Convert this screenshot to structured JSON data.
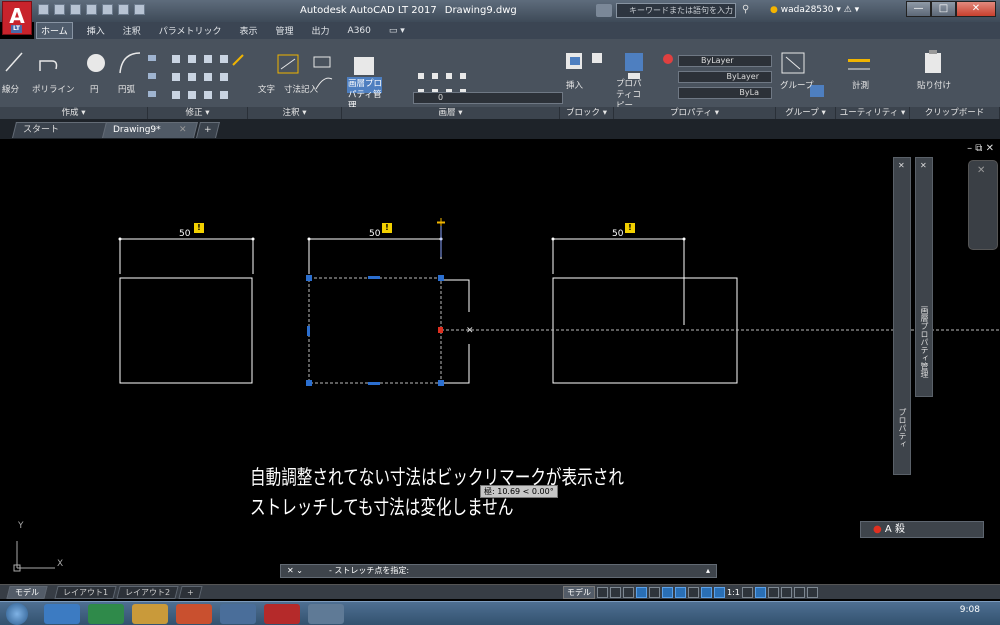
{
  "app": {
    "logo_letter": "A",
    "logo_badge": "LT",
    "title": "Autodesk AutoCAD LT 2017",
    "document": "Drawing9.dwg",
    "search_placeholder": "キーワードまたは語句を入力",
    "user": "wada28530",
    "window_controls": [
      "—",
      "□",
      "✕"
    ]
  },
  "menu": [
    "ホーム",
    "挿入",
    "注釈",
    "パラメトリック",
    "表示",
    "管理",
    "出力",
    "A360"
  ],
  "menu_active": "ホーム",
  "ribbon": {
    "draw": {
      "title": "作成 ▾",
      "buttons": [
        "線分",
        "ポリライン",
        "円",
        "円弧"
      ]
    },
    "modify": {
      "title": "修正 ▾"
    },
    "annotation": {
      "title": "注釈 ▾",
      "buttons": [
        "文字",
        "寸法記入"
      ]
    },
    "layers": {
      "title": "画層 ▾",
      "props_button": "画層プロパティ管理",
      "layer_value": "0"
    },
    "block": {
      "title": "ブロック ▾",
      "insert": "挿入"
    },
    "properties": {
      "title": "プロパティ ▾",
      "match": "プロパティコピー",
      "color": "ByLayer",
      "linetype": "ByLayer",
      "lineweight": "ByLa"
    },
    "groups": {
      "title": "グループ ▾",
      "group": "グループ"
    },
    "utilities": {
      "title": "ユーティリティ ▾",
      "measure": "計測"
    },
    "clipboard": {
      "title": "クリップボード",
      "paste": "貼り付け"
    }
  },
  "doc_tabs": [
    "スタート",
    "Drawing9*"
  ],
  "canvas": {
    "controls": "– ⧉ ✕",
    "dim_values": [
      "50",
      "50",
      "50"
    ],
    "warning_mark": "!",
    "dynamic_input": "極: 10.69 < 0.00°",
    "note_line1": "自動調整されてない寸法はビックリマークが表示され",
    "note_line2": "ストレッチしても寸法は変化しません",
    "palette_properties": "プロパティ",
    "palette_layers": "画層プロパティ管理",
    "ucs_x": "X",
    "ucs_y": "Y"
  },
  "command": {
    "prompt": "- ストレッチ点を指定:"
  },
  "layout_tabs": [
    "モデル",
    "レイアウト1",
    "レイアウト2",
    "+"
  ],
  "status": {
    "model": "モデル",
    "scale": "1:1",
    "anno": "A 殺"
  },
  "taskbar": {
    "time": "9:08"
  }
}
